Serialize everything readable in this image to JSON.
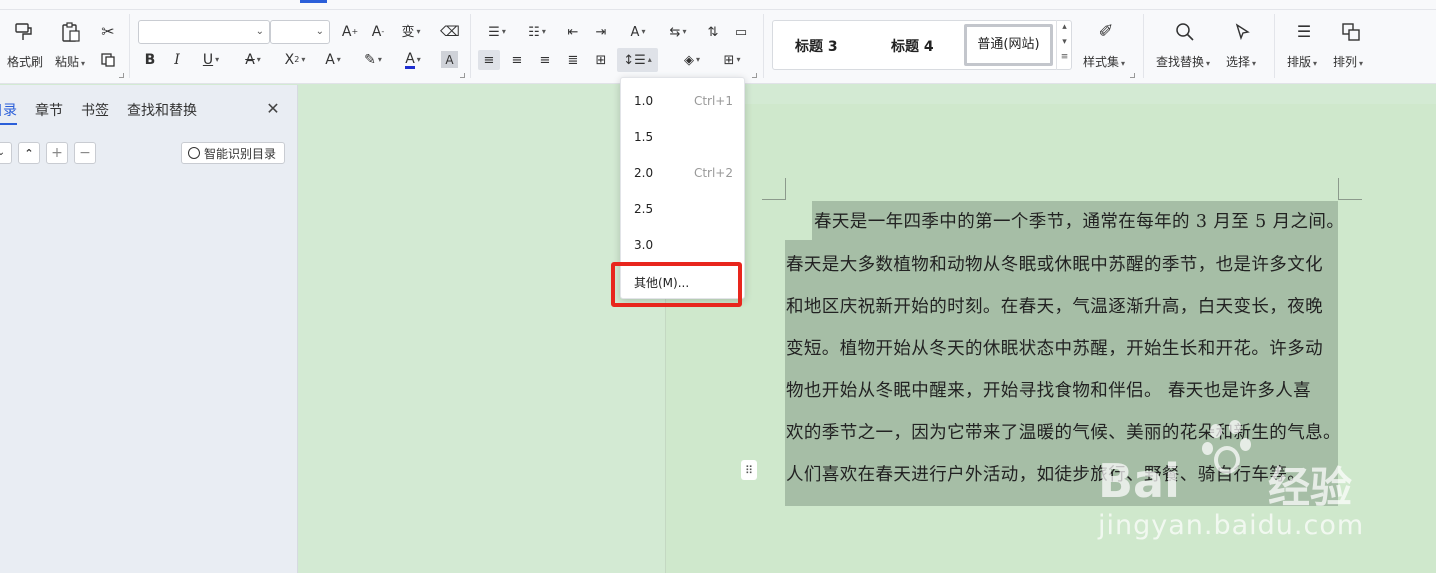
{
  "ribbon": {
    "format_painter_label": "格式刷",
    "paste_label": "粘贴",
    "styles": {
      "heading3": "标题 3",
      "heading4": "标题 4",
      "normal_web": "普通(网站)"
    },
    "style_set_label": "样式集",
    "find_replace_label": "查找替换",
    "select_label": "选择",
    "typeset_label": "排版",
    "arrange_label": "排列"
  },
  "nav_pane": {
    "tabs": [
      "目录",
      "章节",
      "书签",
      "查找和替换"
    ],
    "smart_toc_label": "智能识别目录"
  },
  "line_spacing_menu": {
    "items": [
      {
        "value": "1.0",
        "shortcut": "Ctrl+1"
      },
      {
        "value": "1.5",
        "shortcut": ""
      },
      {
        "value": "2.0",
        "shortcut": "Ctrl+2"
      },
      {
        "value": "2.5",
        "shortcut": ""
      },
      {
        "value": "3.0",
        "shortcut": ""
      },
      {
        "value": "其他(M)...",
        "shortcut": ""
      }
    ],
    "highlight_color": "#e8261d"
  },
  "document": {
    "lines": [
      "春天是一年四季中的第一个季节，通常在每年的 3 月至 5 月之间。",
      "春天是大多数植物和动物从冬眠或休眠中苏醒的季节，也是许多文化",
      "和地区庆祝新开始的时刻。在春天，气温逐渐升高，白天变长，夜晚",
      "变短。植物开始从冬天的休眠状态中苏醒，开始生长和开花。许多动",
      "物也开始从冬眠中醒来，开始寻找食物和伴侣。 春天也是许多人喜",
      "欢的季节之一，因为它带来了温暖的气候、美丽的花朵和新生的气息。",
      "人们喜欢在春天进行户外活动，如徒步旅行、野餐、骑自行车等。"
    ]
  },
  "watermark": {
    "brand": "Bai",
    "brand_cn": "经验",
    "url": "jingyan.baidu.com"
  },
  "colors": {
    "accent": "#2b5fd9",
    "page_bg": "#cfe8cc",
    "selection": "#a6bea6"
  }
}
